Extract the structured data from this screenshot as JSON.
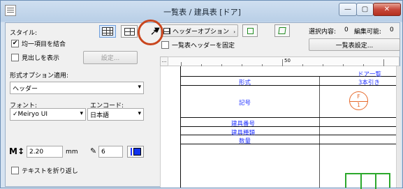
{
  "window": {
    "title": "一覧表 /  建具表 [ドア]"
  },
  "sidebar": {
    "style_label": "スタイル:",
    "merge_label": "均一項目を結合",
    "merge_checked": true,
    "show_header_label": "見出しを表示",
    "show_header_checked": false,
    "settings_label": "設定...",
    "format_apply_label": "形式オプション適用:",
    "format_apply_value": "ヘッダー",
    "font_label": "フォント:",
    "font_value": "✓Meiryo UI",
    "encode_label": "エンコード:",
    "encode_value": "日本語",
    "size_value": "2.20",
    "size_unit": "mm",
    "pen_value": "6",
    "wrap_label": "テキストを折り返し",
    "wrap_checked": false
  },
  "toolbar": {
    "header_option_label": "ヘッダーオプション",
    "fix_header_label": "一覧表ヘッダーを固定",
    "selection_label": "選択内容:",
    "selection_value": "0",
    "editable_label": "編集可能:",
    "editable_value": "0",
    "schedule_settings_label": "一覧表設定..."
  },
  "ruler": {
    "mark": "50",
    "corner": "..."
  },
  "schedule": {
    "header": "ドア一覧",
    "row_form": "形式",
    "form_value": "3本引き",
    "row_symbol": "記号",
    "symbol_top": "F",
    "symbol_bottom": "1",
    "row_fitting_no": "建具番号",
    "row_fitting_type": "建具種類",
    "row_quantity": "数量"
  },
  "colors": {
    "accent": "#2233ff",
    "highlight": "#c9461e",
    "symbol": "#e66a2c"
  }
}
